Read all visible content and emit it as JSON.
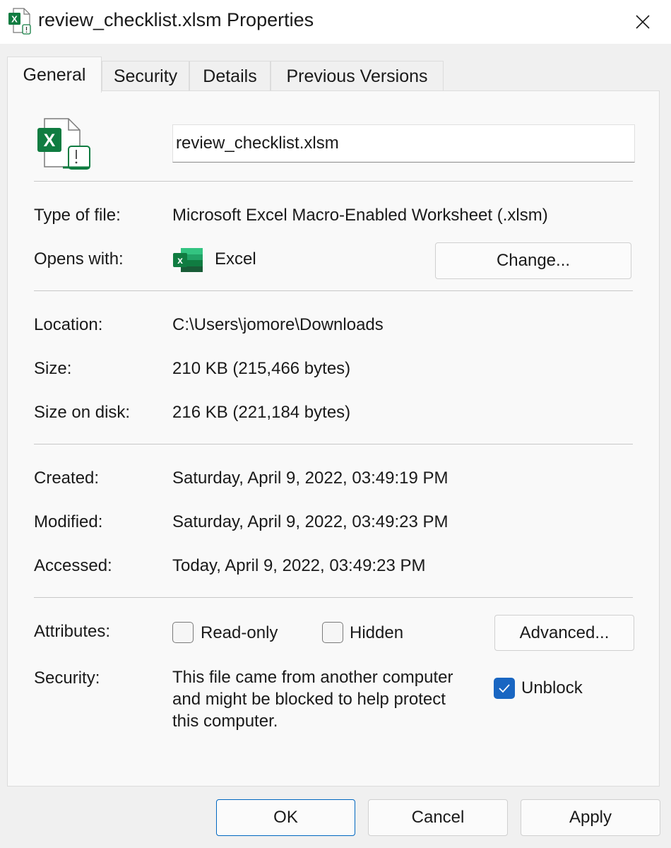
{
  "window": {
    "title": "review_checklist.xlsm Properties"
  },
  "tabs": [
    {
      "label": "General",
      "active": true
    },
    {
      "label": "Security",
      "active": false
    },
    {
      "label": "Details",
      "active": false
    },
    {
      "label": "Previous Versions",
      "active": false
    }
  ],
  "general": {
    "file_name": "review_checklist.xlsm",
    "type_label": "Type of file:",
    "type_value": "Microsoft Excel Macro-Enabled Worksheet (.xlsm)",
    "opens_label": "Opens with:",
    "opens_app": "Excel",
    "change_button": "Change...",
    "location_label": "Location:",
    "location_value": "C:\\Users\\jomore\\Downloads",
    "size_label": "Size:",
    "size_value": "210 KB (215,466 bytes)",
    "size_disk_label": "Size on disk:",
    "size_disk_value": "216 KB (221,184 bytes)",
    "created_label": "Created:",
    "created_value": "Saturday, April 9, 2022, 03:49:19 PM",
    "modified_label": "Modified:",
    "modified_value": "Saturday, April 9, 2022, 03:49:23 PM",
    "accessed_label": "Accessed:",
    "accessed_value": "Today, April 9, 2022, 03:49:23 PM",
    "attributes_label": "Attributes:",
    "readonly_label": "Read-only",
    "readonly_checked": false,
    "hidden_label": "Hidden",
    "hidden_checked": false,
    "advanced_button": "Advanced...",
    "security_label": "Security:",
    "security_text": "This file came from another computer and might be blocked to help protect this computer.",
    "unblock_label": "Unblock",
    "unblock_checked": true
  },
  "footer": {
    "ok": "OK",
    "cancel": "Cancel",
    "apply": "Apply"
  },
  "colors": {
    "excel_green": "#107c41",
    "accent_blue": "#1966c2",
    "panel_bg": "#f9f9f9",
    "window_bg": "#f0f0f0"
  }
}
